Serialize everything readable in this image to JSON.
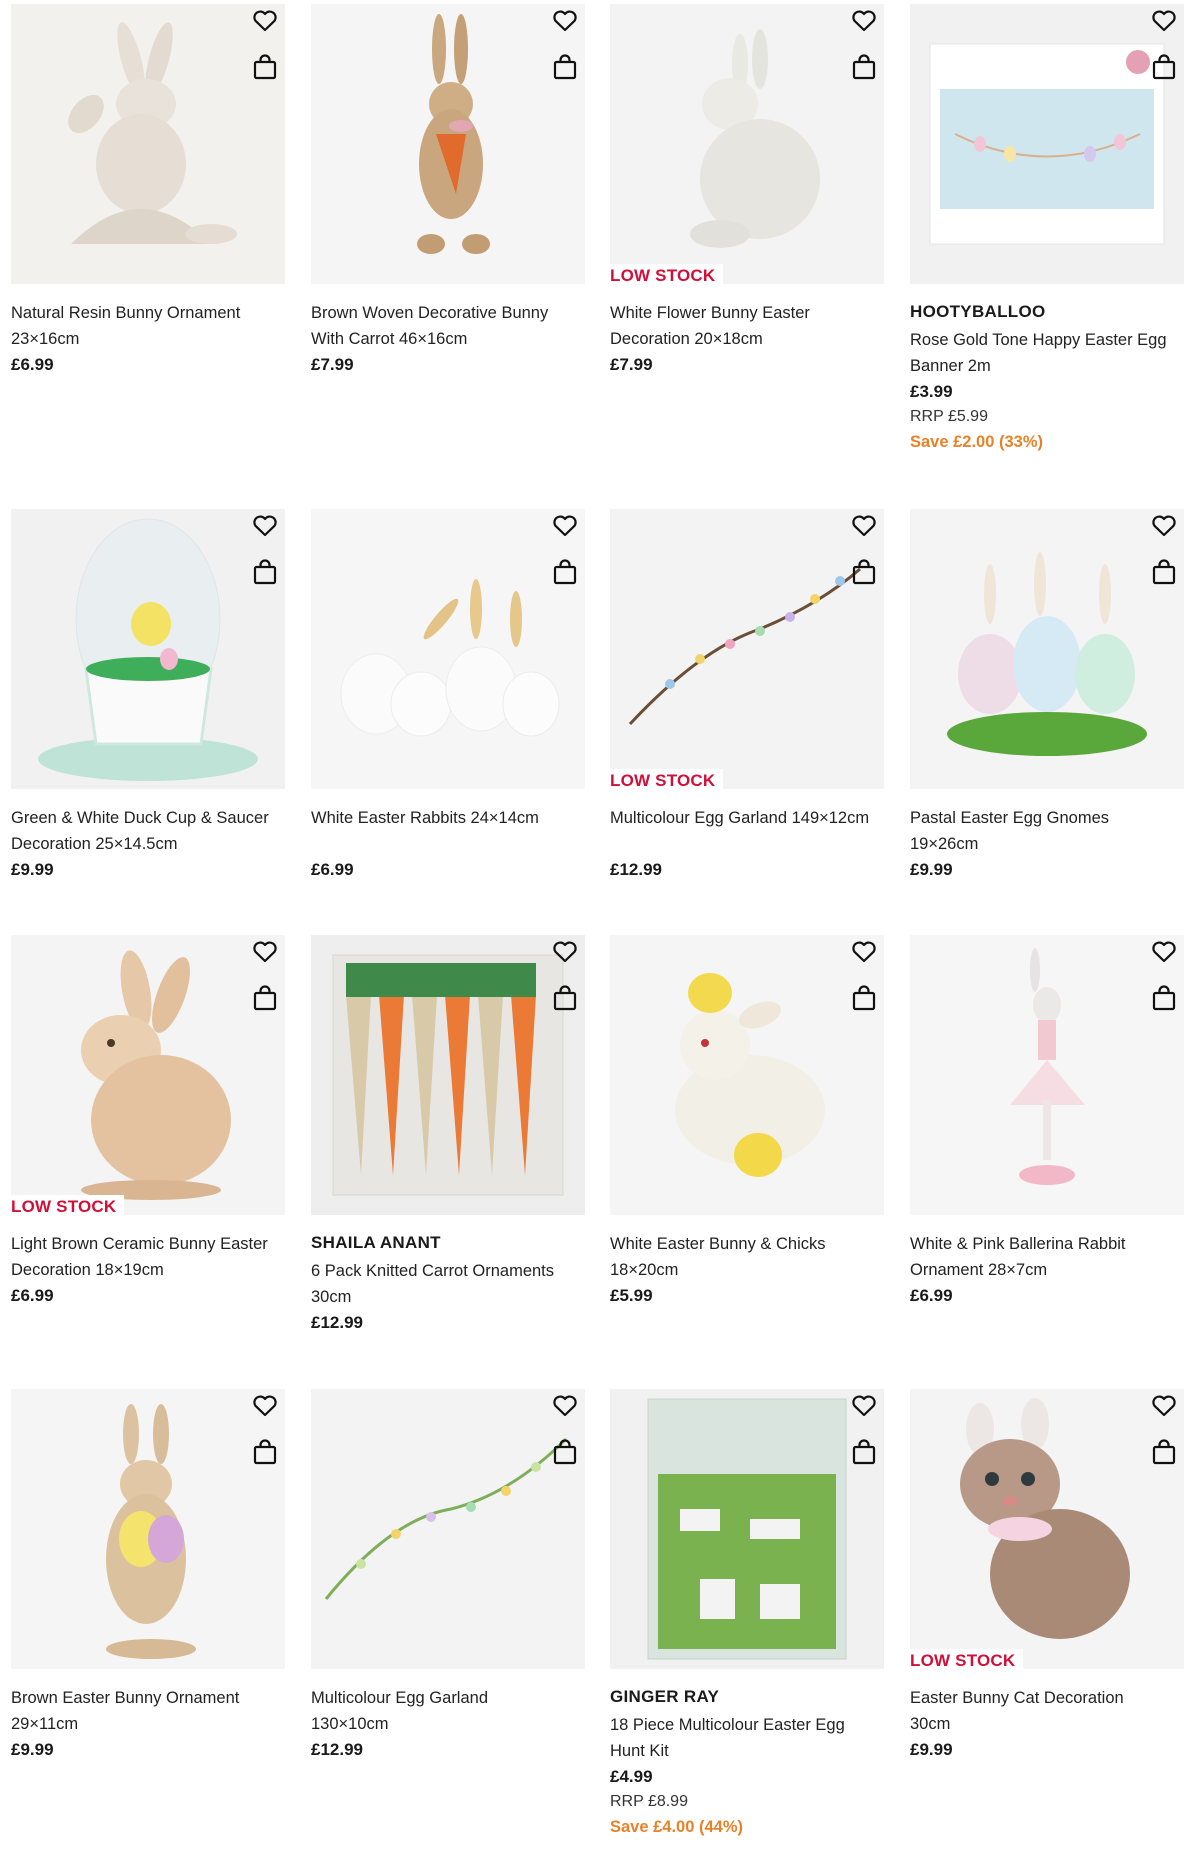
{
  "colors": {
    "low_stock": "#d1103a",
    "save": "#e8822a",
    "image_bg": "#efefef"
  },
  "icons": {
    "wishlist": "heart-icon",
    "bag": "shopping-bag-icon"
  },
  "products": [
    {
      "name_line1": "Natural Resin Bunny Ornament",
      "name_line2": "23×16cm",
      "price": "£6.99"
    },
    {
      "name_line1": "Brown Woven Decorative Bunny",
      "name_line2": "With Carrot 46×16cm",
      "price": "£7.99"
    },
    {
      "badge": "LOW STOCK",
      "name_line1": "White Flower Bunny Easter",
      "name_line2": "Decoration 20×18cm",
      "price": "£7.99"
    },
    {
      "brand": "HOOTYBALLOO",
      "name_line1": "Rose Gold Tone Happy Easter Egg",
      "name_line2": "Banner 2m",
      "price": "£3.99",
      "rrp": "RRP £5.99",
      "save": "Save £2.00 (33%)"
    },
    {
      "name_line1": "Green & White Duck Cup & Saucer",
      "name_line2": "Decoration 25×14.5cm",
      "price": "£9.99"
    },
    {
      "name_line1": "White Easter Rabbits 24×14cm",
      "name_line2": "",
      "price": "£6.99"
    },
    {
      "badge": "LOW STOCK",
      "name_line1": "Multicolour Egg Garland 149×12cm",
      "name_line2": "",
      "price": "£12.99"
    },
    {
      "name_line1": "Pastal Easter Egg Gnomes",
      "name_line2": "19×26cm",
      "price": "£9.99"
    },
    {
      "badge": "LOW STOCK",
      "name_line1": "Light Brown Ceramic Bunny Easter",
      "name_line2": "Decoration 18×19cm",
      "price": "£6.99"
    },
    {
      "brand": "SHAILA ANANT",
      "name_line1": "6 Pack Knitted Carrot Ornaments",
      "name_line2": "30cm",
      "price": "£12.99"
    },
    {
      "name_line1": "White Easter Bunny & Chicks",
      "name_line2": "18×20cm",
      "price": "£5.99"
    },
    {
      "name_line1": "White & Pink Ballerina Rabbit",
      "name_line2": "Ornament 28×7cm",
      "price": "£6.99"
    },
    {
      "name_line1": "Brown Easter Bunny Ornament",
      "name_line2": "29×11cm",
      "price": "£9.99"
    },
    {
      "name_line1": "Multicolour Egg Garland",
      "name_line2": "130×10cm",
      "price": "£12.99"
    },
    {
      "brand": "GINGER RAY",
      "name_line1": "18 Piece Multicolour Easter Egg",
      "name_line2": "Hunt Kit",
      "price": "£4.99",
      "rrp": "RRP £8.99",
      "save": "Save £4.00 (44%)"
    },
    {
      "badge": "LOW STOCK",
      "name_line1": "Easter Bunny Cat Decoration",
      "name_line2": "30cm",
      "price": "£9.99"
    }
  ]
}
